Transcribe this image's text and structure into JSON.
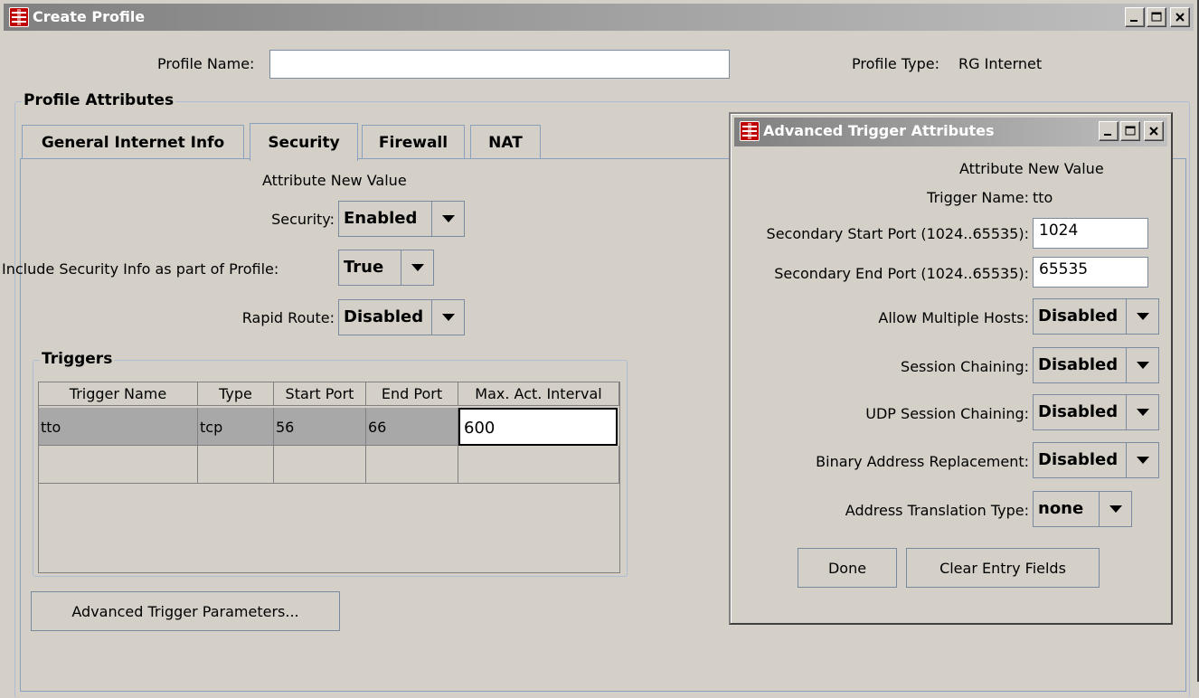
{
  "main_window": {
    "title": "Create Profile",
    "profile_name_label": "Profile Name:",
    "profile_name_value": "",
    "profile_type_label": "Profile Type:",
    "profile_type_value": "RG Internet",
    "attributes_group_title": "Profile Attributes",
    "tabs": [
      {
        "label": "General Internet Info",
        "active": false
      },
      {
        "label": "Security",
        "active": true
      },
      {
        "label": "Firewall",
        "active": false
      },
      {
        "label": "NAT",
        "active": false
      }
    ],
    "security_tab": {
      "header": "Attribute New Value",
      "fields": [
        {
          "label": "Security:",
          "value": "Enabled"
        },
        {
          "label": "Include Security Info as part of Profile:",
          "value": "True"
        },
        {
          "label": "Rapid Route:",
          "value": "Disabled"
        }
      ],
      "triggers": {
        "title": "Triggers",
        "columns": [
          "Trigger Name",
          "Type",
          "Start Port",
          "End Port",
          "Max. Act. Interval"
        ],
        "rows": [
          [
            "tto",
            "tcp",
            "56",
            "66",
            "600"
          ],
          [
            "",
            "",
            "",
            "",
            ""
          ]
        ]
      },
      "advanced_button": "Advanced Trigger Parameters..."
    }
  },
  "dialog": {
    "title": "Advanced Trigger Attributes",
    "header": "Attribute New Value",
    "trigger_name_label": "Trigger Name:",
    "trigger_name_value": "tto",
    "fields": [
      {
        "label": "Secondary Start Port (1024..65535):",
        "value": "1024"
      },
      {
        "label": "Secondary End Port (1024..65535):",
        "value": "65535"
      }
    ],
    "combos": [
      {
        "label": "Allow Multiple Hosts:",
        "value": "Disabled"
      },
      {
        "label": "Session Chaining:",
        "value": "Disabled"
      },
      {
        "label": "UDP Session Chaining:",
        "value": "Disabled"
      },
      {
        "label": "Binary Address Replacement:",
        "value": "Disabled"
      },
      {
        "label": "Address Translation Type:",
        "value": "none"
      }
    ],
    "done_button": "Done",
    "clear_button": "Clear Entry Fields"
  },
  "colors": {
    "window_bg": "#d4d0c8",
    "titlebar_gradient_start": "#808080",
    "titlebar_gradient_end": "#c0c0c0",
    "app_icon": "#c00000",
    "selected_row": "#a8a8a8"
  },
  "icons": [
    "app-icon",
    "minimize-icon",
    "maximize-icon",
    "close-icon",
    "dropdown-arrow-icon"
  ]
}
